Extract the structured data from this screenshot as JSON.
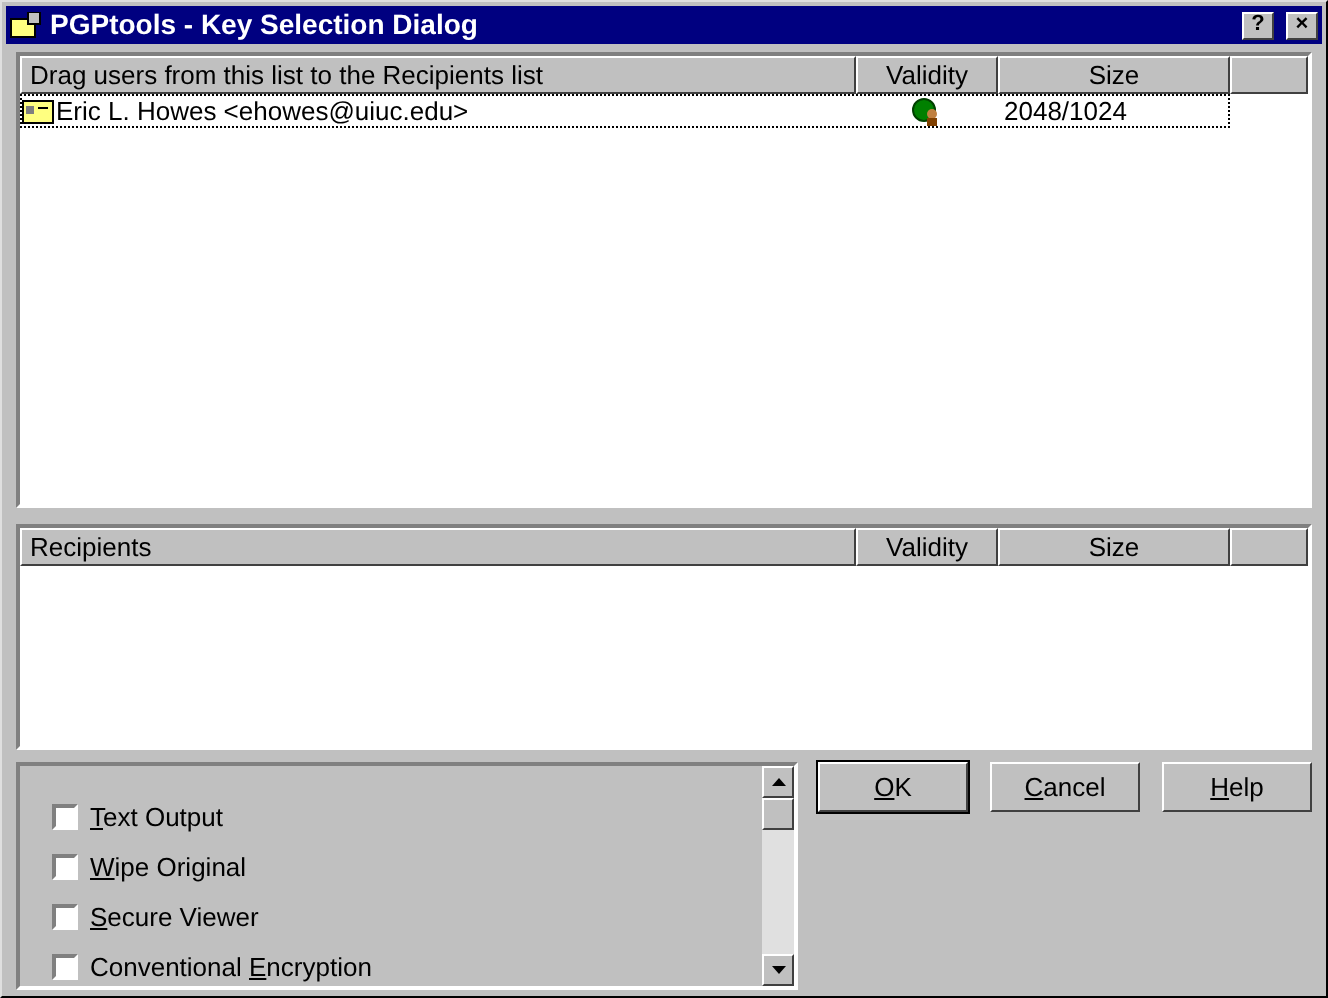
{
  "window": {
    "title": "PGPtools - Key Selection Dialog",
    "buttons": [
      "?",
      "×"
    ]
  },
  "keys_list": {
    "columns": [
      "Drag users from this list to the Recipients list",
      "Validity",
      "Size"
    ],
    "rows": [
      {
        "name": "Eric L. Howes <ehowes@uiuc.edu>",
        "size": "2048/1024",
        "selected": true
      }
    ]
  },
  "recipients_list": {
    "columns": [
      "Recipients",
      "Validity",
      "Size"
    ]
  },
  "options": [
    {
      "access_key": "T",
      "label_after": "ext Output",
      "checked": false
    },
    {
      "access_key": "W",
      "label_after": "ipe Original",
      "checked": false
    },
    {
      "access_key": "S",
      "label_after": "ecure Viewer",
      "checked": false
    },
    {
      "label_before": "Conventional ",
      "access_key": "E",
      "label_after": "ncryption",
      "checked": false
    }
  ],
  "buttons": [
    {
      "access_key": "O",
      "label_after": "K",
      "default": true
    },
    {
      "access_key": "C",
      "label_after": "ancel",
      "default": false
    },
    {
      "access_key": "H",
      "label_after": "elp",
      "default": false
    }
  ]
}
